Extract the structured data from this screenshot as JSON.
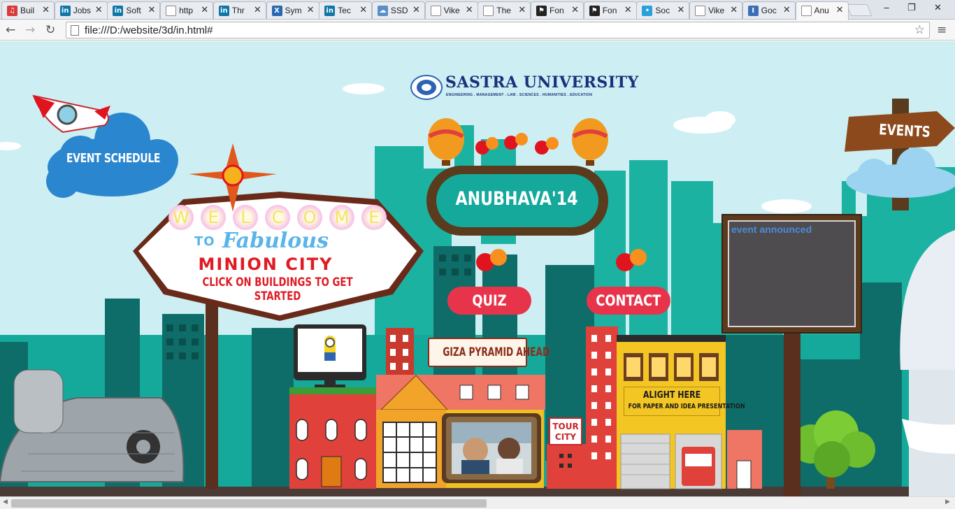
{
  "browser": {
    "tabs": [
      {
        "label": "Buil",
        "icon": "music-icon",
        "icon_color": "#d93a3a",
        "icon_glyph": "♫"
      },
      {
        "label": "Jobs",
        "icon": "linkedin-icon",
        "icon_color": "#0e76a8",
        "icon_glyph": "in"
      },
      {
        "label": "Soft",
        "icon": "linkedin-icon",
        "icon_color": "#0e76a8",
        "icon_glyph": "in"
      },
      {
        "label": "http",
        "icon": "page-icon",
        "icon_color": "#ffffff",
        "icon_glyph": ""
      },
      {
        "label": "Thr",
        "icon": "linkedin-icon",
        "icon_color": "#0e76a8",
        "icon_glyph": "in"
      },
      {
        "label": "Sym",
        "icon": "x-icon",
        "icon_color": "#2a67b1",
        "icon_glyph": "X"
      },
      {
        "label": "Tec",
        "icon": "linkedin-icon",
        "icon_color": "#0e76a8",
        "icon_glyph": "in"
      },
      {
        "label": "SSD",
        "icon": "cloud-icon",
        "icon_color": "#5b8fc7",
        "icon_glyph": "☁"
      },
      {
        "label": "Vike",
        "icon": "page-icon",
        "icon_color": "#ffffff",
        "icon_glyph": ""
      },
      {
        "label": "The",
        "icon": "page-icon",
        "icon_color": "#ffffff",
        "icon_glyph": ""
      },
      {
        "label": "Fon",
        "icon": "flag-icon",
        "icon_color": "#222222",
        "icon_glyph": "⚑"
      },
      {
        "label": "Fon",
        "icon": "flag-icon",
        "icon_color": "#222222",
        "icon_glyph": "⚑"
      },
      {
        "label": "Soc",
        "icon": "social-icon",
        "icon_color": "#2aa0dc",
        "icon_glyph": "•"
      },
      {
        "label": "Vike",
        "icon": "page-icon",
        "icon_color": "#ffffff",
        "icon_glyph": ""
      },
      {
        "label": "Goc",
        "icon": "info-icon",
        "icon_color": "#3d6fb6",
        "icon_glyph": "I"
      },
      {
        "label": "Anu",
        "icon": "page-icon",
        "icon_color": "#ffffff",
        "icon_glyph": "",
        "active": true
      }
    ],
    "tab_close_glyph": "✕",
    "window": {
      "minimize": "‒",
      "maximize": "❐",
      "close": "✕"
    },
    "nav": {
      "back": "←",
      "forward": "→",
      "reload": "↻"
    },
    "url": "file:///D:/website/3d/in.html#",
    "star_glyph": "☆",
    "menu_glyph": "≡"
  },
  "page": {
    "logo": {
      "name": "SASTRA UNIVERSITY",
      "tagline": "ENGINEERING . MANAGEMENT . LAW . SCIENCES . HUMANITIES . EDUCATION"
    },
    "event_schedule": "EVENT SCHEDULE",
    "events": "EVENTS",
    "festival": "ANUBHAVA'14",
    "quiz": "QUIZ",
    "contact": "CONTACT",
    "notice": {
      "text": "event announced"
    },
    "welcome_sign": {
      "letters": [
        "W",
        "E",
        "L",
        "C",
        "O",
        "M",
        "E"
      ],
      "to": "TO",
      "fabulous": "Fabulous",
      "title": "MINION  CITY",
      "subtitle": "CLICK ON BUILDINGS TO GET STARTED"
    },
    "giza": "GIZA PYRAMID AHEAD",
    "tour": {
      "line1": "TOUR",
      "line2": "CITY"
    },
    "alight": {
      "title": "ALIGHT HERE",
      "subtitle": "FOR PAPER AND IDEA PRESENTATION"
    },
    "colors": {
      "sky": "#cdeff3",
      "teal": "#14a99a",
      "dark_teal": "#0f6d69",
      "red_pill": "#e8344a",
      "brown": "#5a3b1d"
    }
  }
}
